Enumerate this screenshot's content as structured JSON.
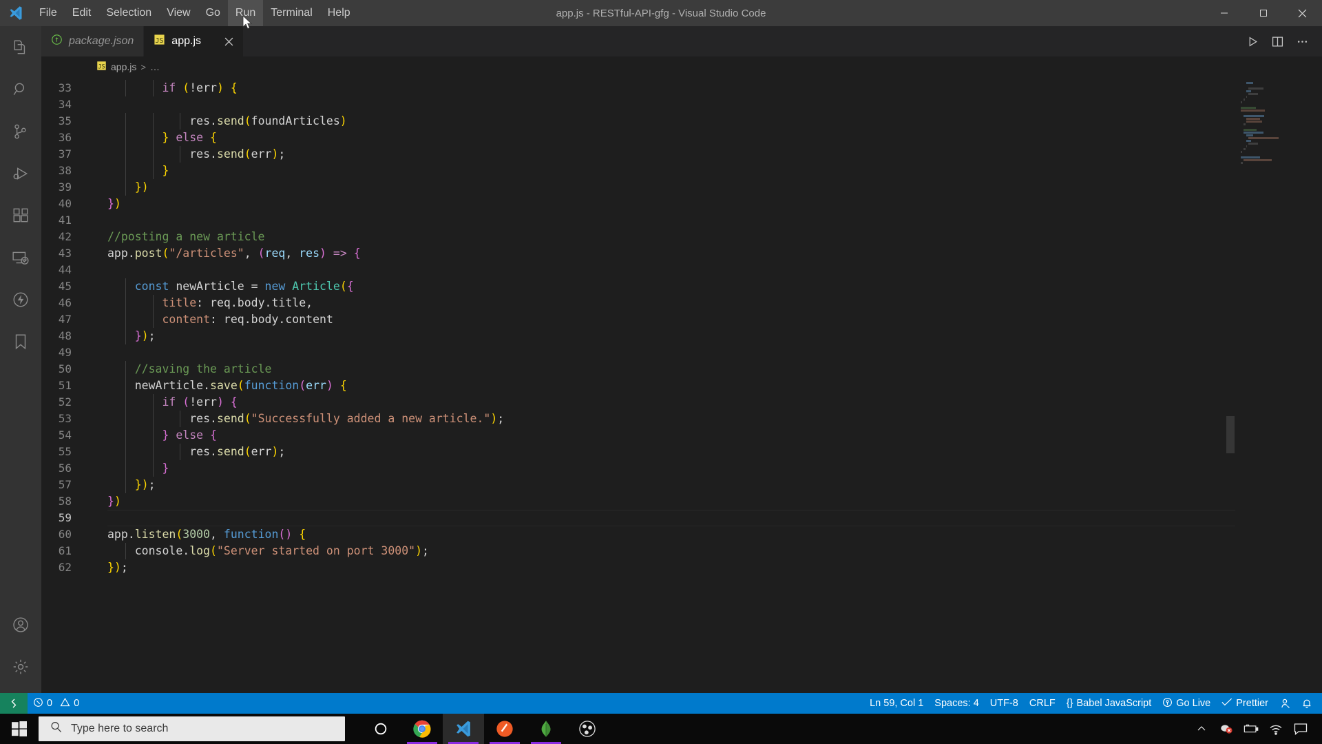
{
  "window": {
    "title": "app.js - RESTful-API-gfg - Visual Studio Code",
    "minimize_label": "–",
    "maximize_label": "❑",
    "close_label": "✕"
  },
  "menubar": {
    "items": [
      {
        "label": "File",
        "active": false
      },
      {
        "label": "Edit",
        "active": false
      },
      {
        "label": "Selection",
        "active": false
      },
      {
        "label": "View",
        "active": false
      },
      {
        "label": "Go",
        "active": false
      },
      {
        "label": "Run",
        "active": true
      },
      {
        "label": "Terminal",
        "active": false
      },
      {
        "label": "Help",
        "active": false
      }
    ]
  },
  "activitybar": {
    "top": [
      {
        "name": "explorer",
        "title": "Explorer",
        "active": false
      },
      {
        "name": "search",
        "title": "Search",
        "active": false
      },
      {
        "name": "source-control",
        "title": "Source Control",
        "active": false
      },
      {
        "name": "run-and-debug",
        "title": "Run and Debug",
        "active": false
      },
      {
        "name": "extensions",
        "title": "Extensions",
        "active": false
      },
      {
        "name": "remote-explorer",
        "title": "Remote Explorer",
        "active": false
      },
      {
        "name": "thunder-client",
        "title": "Thunder Client",
        "active": false
      },
      {
        "name": "bookmarks",
        "title": "Bookmarks",
        "active": false
      }
    ],
    "bottom": [
      {
        "name": "accounts",
        "title": "Accounts"
      },
      {
        "name": "settings",
        "title": "Manage"
      }
    ]
  },
  "tabs": [
    {
      "label": "package.json",
      "icon": "nodejs-icon",
      "active": false,
      "dirty": false
    },
    {
      "label": "app.js",
      "icon": "javascript-icon",
      "active": true,
      "dirty": false
    }
  ],
  "tab_actions": {
    "run_label": "Run or Debug",
    "split_label": "Split Editor",
    "more_label": "More Actions..."
  },
  "breadcrumb": {
    "file": "app.js",
    "separator": ">",
    "ellipsis": "…"
  },
  "editor": {
    "first_line": 33,
    "current_line": 59,
    "lines": [
      {
        "n": 33,
        "tokens": [
          {
            "t": "        ",
            "c": "t-plain"
          },
          {
            "t": "if",
            "c": "t-kw2"
          },
          {
            "t": " ",
            "c": "t-plain"
          },
          {
            "t": "(",
            "c": "t-p1"
          },
          {
            "t": "!",
            "c": "t-op"
          },
          {
            "t": "err",
            "c": "t-plain"
          },
          {
            "t": ")",
            "c": "t-p1"
          },
          {
            "t": " ",
            "c": "t-plain"
          },
          {
            "t": "{",
            "c": "t-p1"
          }
        ]
      },
      {
        "n": 34,
        "tokens": []
      },
      {
        "n": 35,
        "tokens": [
          {
            "t": "            ",
            "c": "t-plain"
          },
          {
            "t": "res",
            "c": "t-plain"
          },
          {
            "t": ".",
            "c": "t-plain"
          },
          {
            "t": "send",
            "c": "t-fn"
          },
          {
            "t": "(",
            "c": "t-p1"
          },
          {
            "t": "foundArticles",
            "c": "t-plain"
          },
          {
            "t": ")",
            "c": "t-p1"
          }
        ]
      },
      {
        "n": 36,
        "tokens": [
          {
            "t": "        ",
            "c": "t-plain"
          },
          {
            "t": "}",
            "c": "t-p1"
          },
          {
            "t": " ",
            "c": "t-plain"
          },
          {
            "t": "else",
            "c": "t-kw2"
          },
          {
            "t": " ",
            "c": "t-plain"
          },
          {
            "t": "{",
            "c": "t-p1"
          }
        ]
      },
      {
        "n": 37,
        "tokens": [
          {
            "t": "            ",
            "c": "t-plain"
          },
          {
            "t": "res",
            "c": "t-plain"
          },
          {
            "t": ".",
            "c": "t-plain"
          },
          {
            "t": "send",
            "c": "t-fn"
          },
          {
            "t": "(",
            "c": "t-p1"
          },
          {
            "t": "err",
            "c": "t-plain"
          },
          {
            "t": ")",
            "c": "t-p1"
          },
          {
            "t": ";",
            "c": "t-plain"
          }
        ]
      },
      {
        "n": 38,
        "tokens": [
          {
            "t": "        ",
            "c": "t-plain"
          },
          {
            "t": "}",
            "c": "t-p1"
          }
        ]
      },
      {
        "n": 39,
        "tokens": [
          {
            "t": "    ",
            "c": "t-plain"
          },
          {
            "t": "}",
            "c": "t-p1"
          },
          {
            "t": ")",
            "c": "t-p1"
          }
        ]
      },
      {
        "n": 40,
        "tokens": [
          {
            "t": "}",
            "c": "t-p2"
          },
          {
            "t": ")",
            "c": "t-p1"
          }
        ]
      },
      {
        "n": 41,
        "tokens": []
      },
      {
        "n": 42,
        "tokens": [
          {
            "t": "//posting a new article",
            "c": "t-com"
          }
        ]
      },
      {
        "n": 43,
        "tokens": [
          {
            "t": "app",
            "c": "t-plain"
          },
          {
            "t": ".",
            "c": "t-plain"
          },
          {
            "t": "post",
            "c": "t-fn"
          },
          {
            "t": "(",
            "c": "t-p1"
          },
          {
            "t": "\"/articles\"",
            "c": "t-str"
          },
          {
            "t": ", ",
            "c": "t-plain"
          },
          {
            "t": "(",
            "c": "t-p2"
          },
          {
            "t": "req",
            "c": "t-var"
          },
          {
            "t": ", ",
            "c": "t-plain"
          },
          {
            "t": "res",
            "c": "t-var"
          },
          {
            "t": ")",
            "c": "t-p2"
          },
          {
            "t": " ",
            "c": "t-plain"
          },
          {
            "t": "=>",
            "c": "t-kw2"
          },
          {
            "t": " ",
            "c": "t-plain"
          },
          {
            "t": "{",
            "c": "t-p2"
          }
        ]
      },
      {
        "n": 44,
        "tokens": []
      },
      {
        "n": 45,
        "tokens": [
          {
            "t": "    ",
            "c": "t-plain"
          },
          {
            "t": "const",
            "c": "t-kw"
          },
          {
            "t": " ",
            "c": "t-plain"
          },
          {
            "t": "newArticle",
            "c": "t-plain"
          },
          {
            "t": " ",
            "c": "t-plain"
          },
          {
            "t": "=",
            "c": "t-op"
          },
          {
            "t": " ",
            "c": "t-plain"
          },
          {
            "t": "new",
            "c": "t-kw"
          },
          {
            "t": " ",
            "c": "t-plain"
          },
          {
            "t": "Article",
            "c": "t-type"
          },
          {
            "t": "(",
            "c": "t-p1"
          },
          {
            "t": "{",
            "c": "t-p2"
          }
        ]
      },
      {
        "n": 46,
        "tokens": [
          {
            "t": "        ",
            "c": "t-plain"
          },
          {
            "t": "title",
            "c": "t-str"
          },
          {
            "t": ": ",
            "c": "t-plain"
          },
          {
            "t": "req",
            "c": "t-plain"
          },
          {
            "t": ".",
            "c": "t-plain"
          },
          {
            "t": "body",
            "c": "t-plain"
          },
          {
            "t": ".",
            "c": "t-plain"
          },
          {
            "t": "title",
            "c": "t-plain"
          },
          {
            "t": ",",
            "c": "t-plain"
          }
        ]
      },
      {
        "n": 47,
        "tokens": [
          {
            "t": "        ",
            "c": "t-plain"
          },
          {
            "t": "content",
            "c": "t-str"
          },
          {
            "t": ": ",
            "c": "t-plain"
          },
          {
            "t": "req",
            "c": "t-plain"
          },
          {
            "t": ".",
            "c": "t-plain"
          },
          {
            "t": "body",
            "c": "t-plain"
          },
          {
            "t": ".",
            "c": "t-plain"
          },
          {
            "t": "content",
            "c": "t-plain"
          }
        ]
      },
      {
        "n": 48,
        "tokens": [
          {
            "t": "    ",
            "c": "t-plain"
          },
          {
            "t": "}",
            "c": "t-p2"
          },
          {
            "t": ")",
            "c": "t-p1"
          },
          {
            "t": ";",
            "c": "t-plain"
          }
        ]
      },
      {
        "n": 49,
        "tokens": []
      },
      {
        "n": 50,
        "tokens": [
          {
            "t": "    ",
            "c": "t-plain"
          },
          {
            "t": "//saving the article",
            "c": "t-com"
          }
        ]
      },
      {
        "n": 51,
        "tokens": [
          {
            "t": "    ",
            "c": "t-plain"
          },
          {
            "t": "newArticle",
            "c": "t-plain"
          },
          {
            "t": ".",
            "c": "t-plain"
          },
          {
            "t": "save",
            "c": "t-fn"
          },
          {
            "t": "(",
            "c": "t-p1"
          },
          {
            "t": "function",
            "c": "t-kw"
          },
          {
            "t": "(",
            "c": "t-p2"
          },
          {
            "t": "err",
            "c": "t-var"
          },
          {
            "t": ")",
            "c": "t-p2"
          },
          {
            "t": " ",
            "c": "t-plain"
          },
          {
            "t": "{",
            "c": "t-p1"
          }
        ]
      },
      {
        "n": 52,
        "tokens": [
          {
            "t": "        ",
            "c": "t-plain"
          },
          {
            "t": "if",
            "c": "t-kw2"
          },
          {
            "t": " ",
            "c": "t-plain"
          },
          {
            "t": "(",
            "c": "t-p2"
          },
          {
            "t": "!",
            "c": "t-op"
          },
          {
            "t": "err",
            "c": "t-plain"
          },
          {
            "t": ")",
            "c": "t-p2"
          },
          {
            "t": " ",
            "c": "t-plain"
          },
          {
            "t": "{",
            "c": "t-p2"
          }
        ]
      },
      {
        "n": 53,
        "tokens": [
          {
            "t": "            ",
            "c": "t-plain"
          },
          {
            "t": "res",
            "c": "t-plain"
          },
          {
            "t": ".",
            "c": "t-plain"
          },
          {
            "t": "send",
            "c": "t-fn"
          },
          {
            "t": "(",
            "c": "t-p1"
          },
          {
            "t": "\"Successfully added a new article.\"",
            "c": "t-str"
          },
          {
            "t": ")",
            "c": "t-p1"
          },
          {
            "t": ";",
            "c": "t-plain"
          }
        ]
      },
      {
        "n": 54,
        "tokens": [
          {
            "t": "        ",
            "c": "t-plain"
          },
          {
            "t": "}",
            "c": "t-p2"
          },
          {
            "t": " ",
            "c": "t-plain"
          },
          {
            "t": "else",
            "c": "t-kw2"
          },
          {
            "t": " ",
            "c": "t-plain"
          },
          {
            "t": "{",
            "c": "t-p2"
          }
        ]
      },
      {
        "n": 55,
        "tokens": [
          {
            "t": "            ",
            "c": "t-plain"
          },
          {
            "t": "res",
            "c": "t-plain"
          },
          {
            "t": ".",
            "c": "t-plain"
          },
          {
            "t": "send",
            "c": "t-fn"
          },
          {
            "t": "(",
            "c": "t-p1"
          },
          {
            "t": "err",
            "c": "t-plain"
          },
          {
            "t": ")",
            "c": "t-p1"
          },
          {
            "t": ";",
            "c": "t-plain"
          }
        ]
      },
      {
        "n": 56,
        "tokens": [
          {
            "t": "        ",
            "c": "t-plain"
          },
          {
            "t": "}",
            "c": "t-p2"
          }
        ]
      },
      {
        "n": 57,
        "tokens": [
          {
            "t": "    ",
            "c": "t-plain"
          },
          {
            "t": "}",
            "c": "t-p1"
          },
          {
            "t": ")",
            "c": "t-p1"
          },
          {
            "t": ";",
            "c": "t-plain"
          }
        ]
      },
      {
        "n": 58,
        "tokens": [
          {
            "t": "}",
            "c": "t-p2"
          },
          {
            "t": ")",
            "c": "t-p1"
          }
        ]
      },
      {
        "n": 59,
        "tokens": []
      },
      {
        "n": 60,
        "tokens": [
          {
            "t": "app",
            "c": "t-plain"
          },
          {
            "t": ".",
            "c": "t-plain"
          },
          {
            "t": "listen",
            "c": "t-fn"
          },
          {
            "t": "(",
            "c": "t-p1"
          },
          {
            "t": "3000",
            "c": "t-num"
          },
          {
            "t": ", ",
            "c": "t-plain"
          },
          {
            "t": "function",
            "c": "t-kw"
          },
          {
            "t": "(",
            "c": "t-p2"
          },
          {
            "t": ")",
            "c": "t-p2"
          },
          {
            "t": " ",
            "c": "t-plain"
          },
          {
            "t": "{",
            "c": "t-p1"
          }
        ]
      },
      {
        "n": 61,
        "tokens": [
          {
            "t": "    ",
            "c": "t-plain"
          },
          {
            "t": "console",
            "c": "t-plain"
          },
          {
            "t": ".",
            "c": "t-plain"
          },
          {
            "t": "log",
            "c": "t-fn"
          },
          {
            "t": "(",
            "c": "t-p1"
          },
          {
            "t": "\"Server started on port 3000\"",
            "c": "t-str"
          },
          {
            "t": ")",
            "c": "t-p1"
          },
          {
            "t": ";",
            "c": "t-plain"
          }
        ]
      },
      {
        "n": 62,
        "tokens": [
          {
            "t": "}",
            "c": "t-p1"
          },
          {
            "t": ")",
            "c": "t-p1"
          },
          {
            "t": ";",
            "c": "t-plain"
          }
        ]
      }
    ]
  },
  "statusbar": {
    "remote_label": "",
    "errors": "0",
    "warnings": "0",
    "cursor_position": "Ln 59, Col 1",
    "indentation": "Spaces: 4",
    "encoding": "UTF-8",
    "eol": "CRLF",
    "language": "Babel JavaScript",
    "golive": "Go Live",
    "prettier": "Prettier",
    "colors": {
      "background": "#007acc",
      "remote": "#16825d"
    }
  },
  "taskbar": {
    "search_placeholder": "Type here to search",
    "apps": [
      {
        "name": "cortana",
        "label": "Cortana",
        "active": false,
        "running": false
      },
      {
        "name": "google-chrome",
        "label": "Google Chrome",
        "active": false,
        "running": true
      },
      {
        "name": "visual-studio-code",
        "label": "Visual Studio Code",
        "active": true,
        "running": true
      },
      {
        "name": "postman",
        "label": "Postman",
        "active": false,
        "running": true
      },
      {
        "name": "mongodb-compass",
        "label": "MongoDB Compass",
        "active": false,
        "running": true
      },
      {
        "name": "obs-studio",
        "label": "OBS Studio",
        "active": false,
        "running": false
      }
    ],
    "tray": [
      {
        "name": "show-hidden-icons",
        "label": "Show hidden icons"
      },
      {
        "name": "antivirus",
        "label": "Antivirus"
      },
      {
        "name": "battery",
        "label": "Battery"
      },
      {
        "name": "network",
        "label": "Network"
      },
      {
        "name": "action-center",
        "label": "Action Center"
      }
    ]
  }
}
